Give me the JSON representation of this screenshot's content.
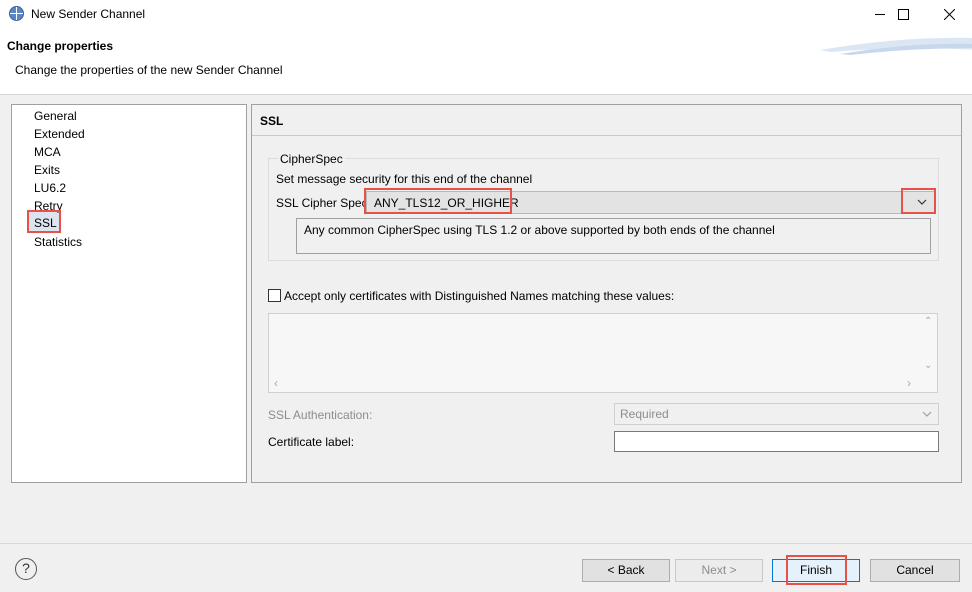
{
  "window": {
    "title": "New Sender Channel",
    "controls": [
      "minimize",
      "maximize",
      "close"
    ]
  },
  "header": {
    "title": "Change properties",
    "description": "Change the properties of the new Sender Channel"
  },
  "nav": {
    "items": [
      "General",
      "Extended",
      "MCA",
      "Exits",
      "LU6.2",
      "Retry",
      "SSL",
      "Statistics"
    ],
    "selected": "SSL"
  },
  "panel": {
    "title": "SSL",
    "cipherspec": {
      "group_label": "CipherSpec",
      "description": "Set message security for this end of the channel",
      "label": "SSL Cipher Spec:",
      "value": "ANY_TLS12_OR_HIGHER",
      "info": "Any common CipherSpec using TLS 1.2 or above supported by both ends of the channel"
    },
    "accept_dn": {
      "label": "Accept only certificates with Distinguished Names matching these values:",
      "checked": false
    },
    "ssl_auth": {
      "label": "SSL Authentication:",
      "value": "Required",
      "enabled": false
    },
    "cert_label": {
      "label": "Certificate label:",
      "value": ""
    }
  },
  "footer": {
    "help": "?",
    "back": "< Back",
    "next": "Next >",
    "finish": "Finish",
    "cancel": "Cancel"
  },
  "colors": {
    "highlight": "#e8504a",
    "selection": "#dde4ef",
    "default_button_border": "#0078d7"
  }
}
